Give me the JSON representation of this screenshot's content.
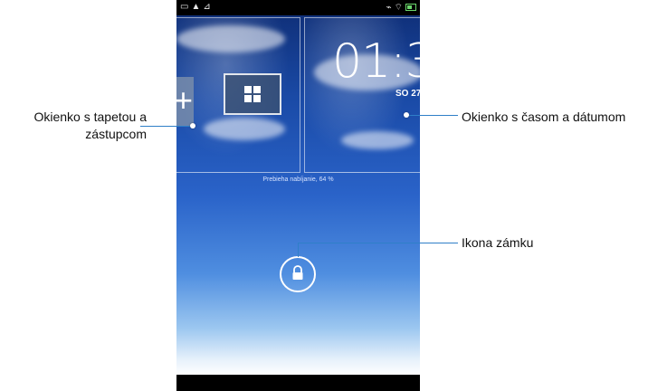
{
  "callouts": {
    "wallpaper_shortcut": "Okienko s tapetou a zástupcom",
    "time_date": "Okienko s časom a dátumom",
    "lock_icon": "Ikona zámku"
  },
  "phone": {
    "clock": "01:3",
    "date": "SO 27",
    "charging_status": "Prebieha nabíjanie, 64 %"
  },
  "colors": {
    "leader_line": "#2f7fc8",
    "status_bar": "#000000"
  },
  "icons": [
    "calendar-icon",
    "warning-icon",
    "screenshot-icon",
    "mute-icon",
    "wifi-icon",
    "battery-icon",
    "plus-icon",
    "widgets-icon",
    "lock-icon"
  ]
}
